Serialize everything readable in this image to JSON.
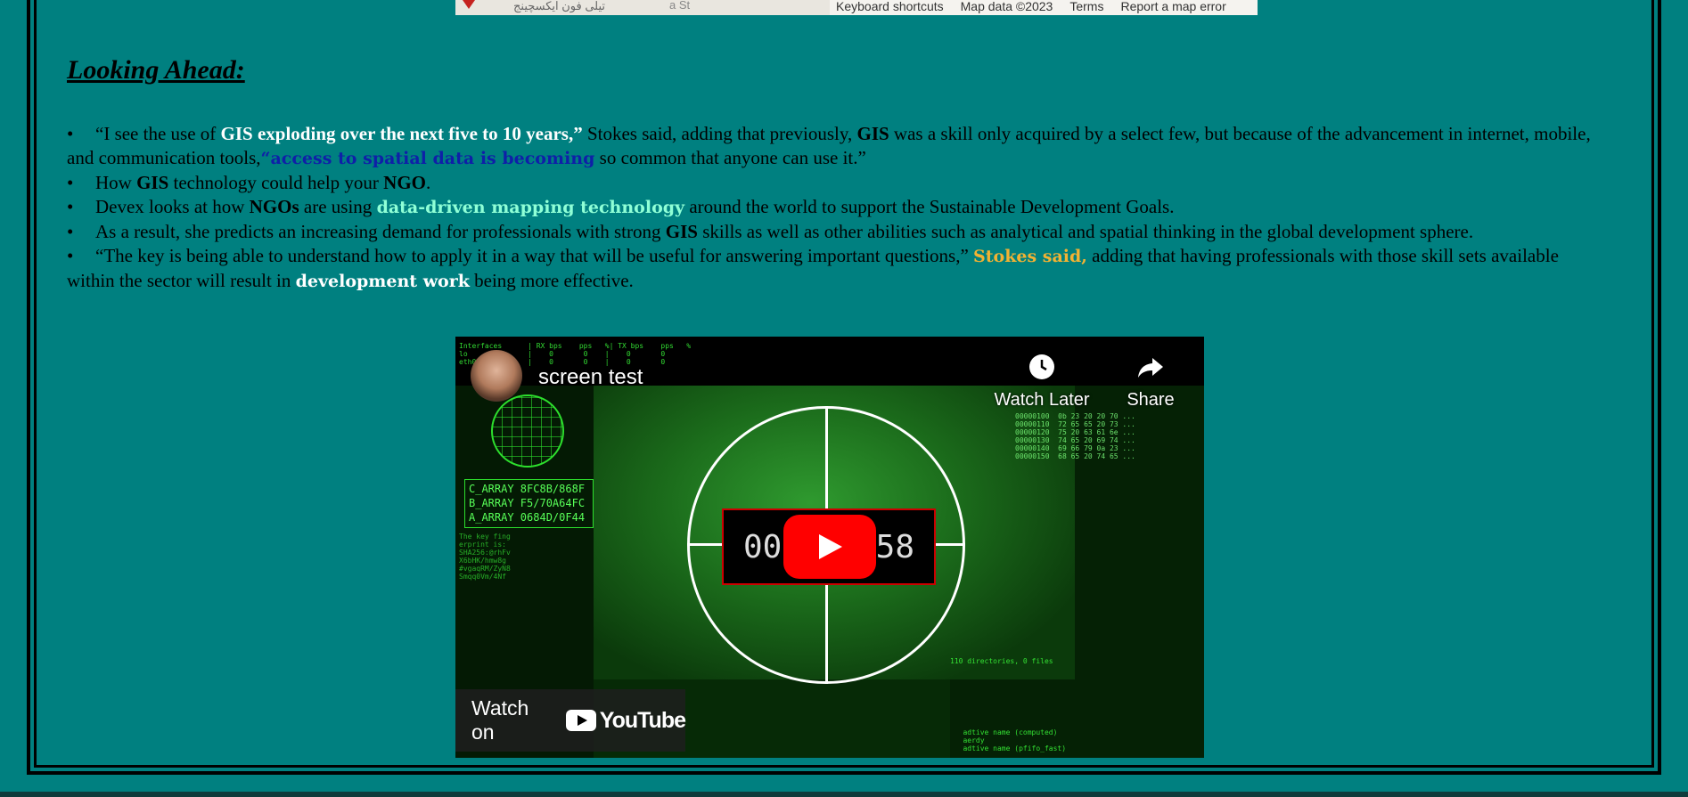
{
  "map": {
    "arabic_label": "تیلی فون ایکسچینج",
    "road_label": "a St",
    "links": [
      "Keyboard shortcuts",
      "Map data ©2023",
      "Terms",
      "Report a map error"
    ]
  },
  "section": {
    "heading": "Looking Ahead:"
  },
  "bullets": {
    "b1": {
      "t1": "“I see the use of ",
      "t2": "GIS exploding over the next five to 10 years,”",
      "t3": " Stokes said, adding that previously, ",
      "t4": "GIS",
      "t5": " was a skill only acquired by a select few, but because of the advancement in internet, mobile, and communication tools,",
      "t6": "“access to spatial data is becoming",
      "t7": " so common that anyone can use it.”"
    },
    "b2": {
      "t1": "How ",
      "t2": "GIS",
      "t3": " technology could help your ",
      "t4": "NGO",
      "t5": "."
    },
    "b3": {
      "t1": "Devex looks at how ",
      "t2": "NGOs",
      "t3": " are using ",
      "t4": "data-driven mapping technology",
      "t5": " around the world to support the Sustainable Development Goals."
    },
    "b4": {
      "t1": "As a result, she predicts an increasing demand for professionals with strong ",
      "t2": "GIS",
      "t3": " skills as well as other abilities such as analytical and spatial thinking in the global development sphere."
    },
    "b5": {
      "t1": "“The key is being able to understand how to apply it in a way that will be useful for answering important questions,” ",
      "t2": "Stokes said,",
      "t3": " adding that having professionals with those skill sets available within the sector will result in ",
      "t4": "development work",
      "t5": " being more effective."
    }
  },
  "video": {
    "title": "screen test",
    "watch_later": "Watch Later",
    "share": "Share",
    "watch_on": "Watch on",
    "youtube": "YouTube",
    "timer_left": "00",
    "timer_right": "58",
    "arrays": [
      "C_ARRAY 8FC8B/868F",
      "B_ARRAY F5/70A64FC",
      "A_ARRAY 0684D/0F44"
    ],
    "icons": [
      "clock-icon",
      "share-arrow-icon",
      "play-icon",
      "youtube-logo-icon"
    ],
    "colors": {
      "accent": "#ff0000",
      "terminal": "#3bff3b"
    }
  },
  "colors": {
    "page_bg": "#008080",
    "link_blue": "#0f1fa8",
    "mint": "#8fffd6",
    "gold": "#f2b233"
  }
}
